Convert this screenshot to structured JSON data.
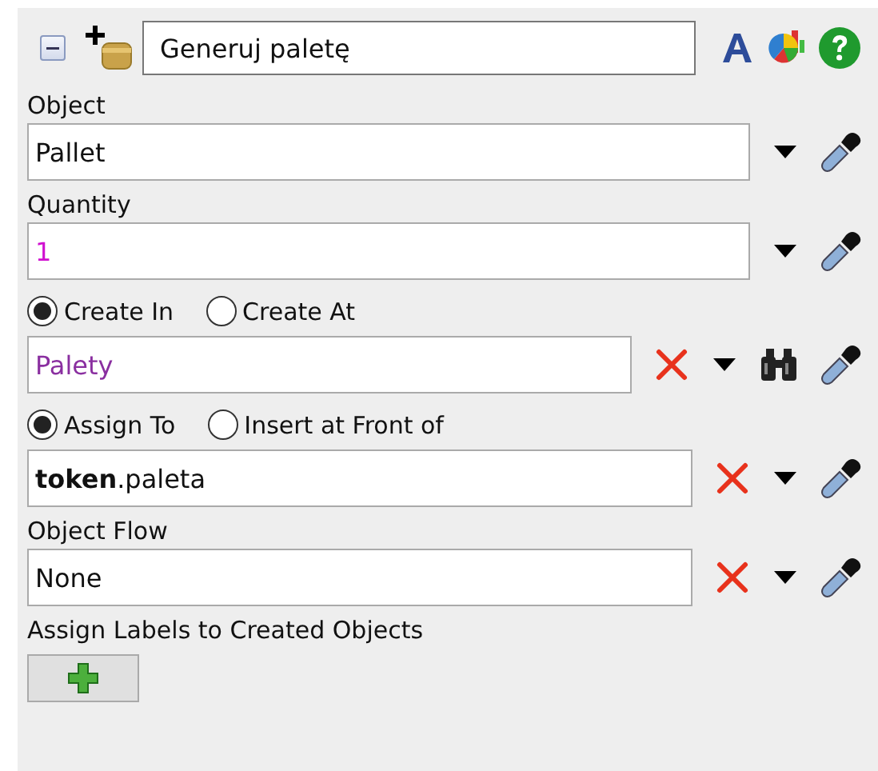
{
  "header": {
    "expanded": true,
    "title": "Generuj paletę"
  },
  "sections": [
    {
      "label": "Object",
      "field": {
        "value": "Pallet",
        "kind": "text",
        "clearable": false,
        "browse": false
      }
    },
    {
      "label": "Quantity",
      "field": {
        "value": "1",
        "kind": "number",
        "clearable": false,
        "browse": false
      }
    },
    {
      "radios": [
        {
          "label": "Create In",
          "selected": true
        },
        {
          "label": "Create At",
          "selected": false
        }
      ],
      "field": {
        "value": "Palety",
        "kind": "object",
        "clearable": true,
        "browse": true
      }
    },
    {
      "radios": [
        {
          "label": "Assign To",
          "selected": true
        },
        {
          "label": "Insert at Front of",
          "selected": false
        }
      ],
      "field": {
        "value": "**token**.paleta",
        "kind": "text",
        "clearable": true,
        "browse": false
      }
    },
    {
      "label": "Object Flow",
      "field": {
        "value": "None",
        "kind": "text",
        "clearable": true,
        "browse": false
      }
    }
  ],
  "labels_section": {
    "label": "Assign Labels to Created Objects"
  }
}
